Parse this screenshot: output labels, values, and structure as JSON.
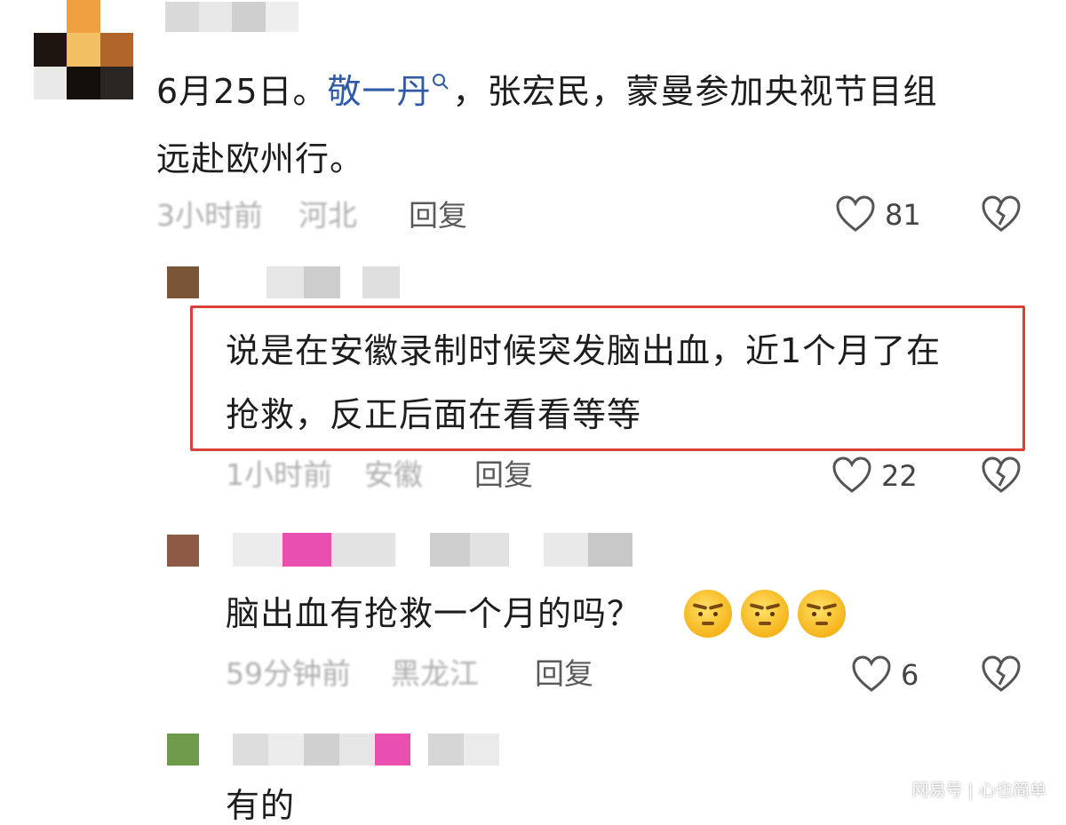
{
  "comments": [
    {
      "text_before_mention": "6月25日。",
      "mention": "敬一丹",
      "text_after_mention": "，张宏民，蒙曼参加央视节目组",
      "text_line2": "远赴欧州行。",
      "time": "3小时前",
      "location": "河北",
      "reply_label": "回复",
      "likes": "81"
    },
    {
      "text_line1": "说是在安徽录制时候突发脑出血，近1个月了在",
      "text_line2": "抢救，反正后面在看看等等",
      "time": "1小时前",
      "location": "安徽",
      "reply_label": "回复",
      "likes": "22"
    },
    {
      "text": "脑出血有抢救一个月的吗？",
      "time": "59分钟前",
      "location": "黑龙江",
      "reply_label": "回复",
      "likes": "6"
    },
    {
      "text": "有的"
    }
  ],
  "watermark": "网易号 | 心也简单",
  "icons": {
    "like": "heart-outline-icon",
    "dislike": "broken-heart-icon",
    "search": "search-icon",
    "emoji": "frowning-face-emoji"
  },
  "colors": {
    "mention": "#2f5aa6",
    "highlight_box": "#d9403a",
    "meta_text": "#9a9a9a"
  }
}
